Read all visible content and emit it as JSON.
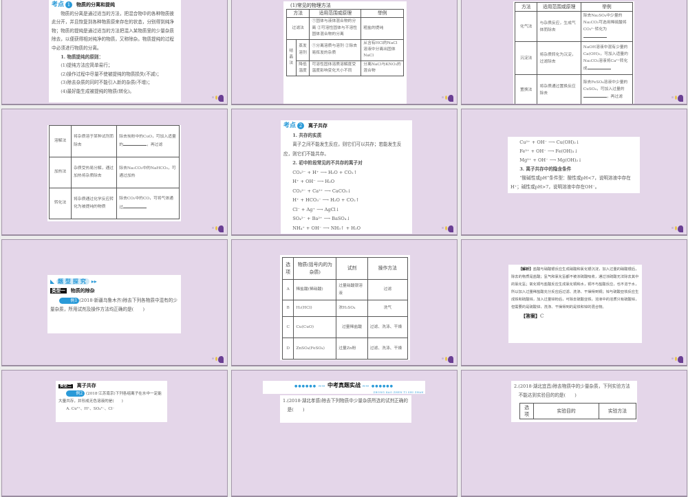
{
  "slides": [
    {
      "kaodian": "考点",
      "num": "1",
      "title": "物质的分离和提纯",
      "para": "物质的分离是通过适当的方法，把混合物中的各种物质彼此分开，并且恢复到各种物质原来存在的状态，分别得到纯净物；物质的提纯是通过适当的方法把混入某物质里的少量杂质除去，以便获得相对纯净的物质，又称除杂。物质提纯的过程中必须进行物质的分离。",
      "list_title": "1. 物质提纯的原则：",
      "items": [
        "(1)提纯方法应简单易行；",
        "(2)操作过程中尽量不使被提纯的物质损失(不减)；",
        "(3)除去杂质的同时不能引入新的杂质(不增)；",
        "(4)最好能生成被提纯的物质(转化)。"
      ]
    },
    {
      "caption": "(1)常见的物理方法",
      "headers": [
        "方法",
        "适用范围或原理",
        "举例"
      ],
      "r1": {
        "method": "过滤法",
        "principle": "①固体与液体混合物的分离 ②可溶性固体与不溶性固体混合物的分离",
        "example": "粗盐的提纯"
      },
      "group": "结晶法",
      "r2": {
        "method": "蒸发溶剂",
        "principle": "①分离溶质与溶剂 ②除去易挥发的杂质",
        "example": "从含有HCl的NaCl溶液中分离出固体NaCl"
      },
      "r3": {
        "method": "降低温度",
        "principle": "可溶性固体溶质溶解度受温度影响变化大小不同",
        "example": "分离NaCl与KNO₃的混合物"
      }
    },
    {
      "headers": [
        "方法",
        "适用范围或原理",
        "举例"
      ],
      "rows": [
        {
          "method": "化气法",
          "principle": "与杂质反应，生成气体而除去",
          "example": "除去Na₂SO₄中少量的Na₂CO₃可选用稀硫酸将CO₃²⁻转化为"
        },
        {
          "method": "沉淀法",
          "principle": "将杂质转化为沉淀，过滤除去",
          "example": "NaOH溶液中混有少量的Ca(OH)₂，可加入适量的Na₂CO₃溶液将Ca²⁺转化成"
        },
        {
          "method": "置换法",
          "principle": "将杂质通过置换反应除去",
          "example": "除去FeSO₄溶液中少量的CuSO₄，可加入过量的",
          "example_tail": "，再过滤"
        }
      ]
    },
    {
      "rows": [
        {
          "method": "溶解法",
          "principle": "将杂质溶于某种试剂而除去",
          "example": "除去炭粉中的CuO，可加入适量的",
          "tail": "，再过滤"
        },
        {
          "method": "加热法",
          "principle": "杂质受热易分解，通过加热将杂质除去",
          "example": "除去Na₂CO₃中的NaHCO₃，可通过加热"
        },
        {
          "method": "转化法",
          "principle": "将杂质通过化学反应转化为被提纯的物质",
          "example": "除去CO₂中的CO，可将气体通过"
        }
      ]
    },
    {
      "kaodian": "考点",
      "num": "2",
      "title": "离子共存",
      "s1": "1. 共存的实质",
      "p1": "离子之间不能发生反应，则它们可以共存；若能发生反应，则它们不能共存。",
      "s2": "2. 初中阶段常见的不共存的离子对",
      "eqs": [
        "CO₃²⁻ + H⁺ ⟶ H₂O + CO₂↑",
        "H⁺ + OH⁻ ⟶ H₂O",
        "CO₃²⁻ + Ca²⁺ ⟶ CaCO₃↓",
        "H⁺ + HCO₃⁻ ⟶ H₂O + CO₂↑",
        "Cl⁻ + Ag⁺ ⟶ AgCl↓",
        "SO₄²⁻ + Ba²⁺ ⟶ BaSO₄↓",
        "NH₄⁺ + OH⁻ ⟶ NH₃↑ + H₂O"
      ]
    },
    {
      "eqs": [
        "Cu²⁺ + OH⁻ ⟶ Cu(OH)₂↓",
        "Fe³⁺ + OH⁻ ⟶ Fe(OH)₃↓",
        "Mg²⁺ + OH⁻ ⟶ Mg(OH)₂↓"
      ],
      "s3": "3. 离子共存中的隐含条件",
      "p": "“酸碱性或pH”条件型：酸性或pH<7，说明溶液中存在H⁺；碱性或pH>7，说明溶液中存在OH⁻。"
    },
    {
      "banner": "题型探究",
      "type_tag": "类型一",
      "type_title": "物质的除杂",
      "ex": "例1",
      "q": "(2018·新疆乌鲁木齐)除去下列各物质中混有的少量杂质，所用试剂及操作方法均正确的是(　　)"
    },
    {
      "headers": [
        "选项",
        "物质(括号内的为杂质)",
        "试剂",
        "操作方法"
      ],
      "rows": [
        [
          "A",
          "稀盐酸(稀硝酸)",
          "过量硝酸银溶液",
          "过滤"
        ],
        [
          "B",
          "H₂(HCl)",
          "浓H₂SO₄",
          "洗气"
        ],
        [
          "C",
          "Cu(CuO)",
          "过量稀盐酸",
          "过滤、洗涤、干燥"
        ],
        [
          "D",
          "ZnSO₄(FeSO₄)",
          "过量Zn粉",
          "过滤、洗涤、干燥"
        ]
      ]
    },
    {
      "jiexi_label": "【解析】",
      "jiexi": "盐酸与硝酸银反应生成硝酸和氯化银沉淀，加入过量的硝酸银后，除去的物质是盐酸；氢气和氯化氢都不被浓硫酸吸收，通过浓硫酸无法除去其中的氯化氢；氧化铜与盐酸反应生成氯化铜和水，铜不与盐酸反应，也不溶于水，所以加入过量稀盐酸充分反应后过滤、洗涤、干燥得到铜；锌与硫酸亚铁反应生成铁和硫酸锌，加入过量锌粉后，可除去硫酸亚铁，溶液中的溶质只有硫酸锌，但需要的是硫酸锌，洗涤、干燥得到的是铁和锌的混合物。",
      "answer_label": "【答案】",
      "answer": "C"
    },
    {
      "type_tag": "类型二",
      "type_title": "离子共存",
      "ex": "例2",
      "q": "(2018·江苏南京)下列各组离子在水中一定能大量共存，并形成无色溶液的是(　　)",
      "opt": "A. Cu²⁺、H⁺、SO₄²⁻、Cl⁻"
    },
    {
      "banner": "中考真题实战",
      "banner_pinyin": "ZHONG KAO ZHEN TI SHI ZHAN",
      "q": "1.(2018·湖北孝感)除去下列物质中少量杂质所选的试剂正确的是(　　)"
    },
    {
      "q": "2.(2018·湖北宜昌)除去物质中的少量杂质，下列实验方法不能达到实验目的的是(　　)",
      "headers": [
        "选项",
        "实验目的",
        "实验方法"
      ]
    }
  ],
  "colors": {
    "slide_bg": "#e4d6e9",
    "accent": "#2a9ad8"
  }
}
